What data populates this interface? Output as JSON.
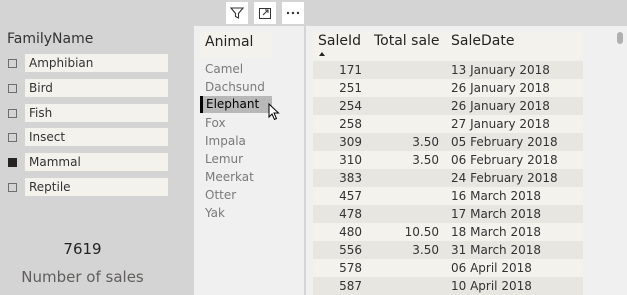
{
  "family_slicer": {
    "title": "FamilyName",
    "items": [
      {
        "label": "Amphibian",
        "checked": false
      },
      {
        "label": "Bird",
        "checked": false
      },
      {
        "label": "Fish",
        "checked": false
      },
      {
        "label": "Insect",
        "checked": false
      },
      {
        "label": "Mammal",
        "checked": true
      },
      {
        "label": "Reptile",
        "checked": false
      }
    ]
  },
  "card": {
    "value": "7619",
    "label": "Number of sales"
  },
  "visual_header": {
    "icons": [
      "filter-icon",
      "focus-mode-icon",
      "more-options-icon"
    ]
  },
  "animal_table": {
    "header": "Animal",
    "rows": [
      "Camel",
      "Dachsund",
      "Elephant",
      "Fox",
      "Impala",
      "Lemur",
      "Meerkat",
      "Otter",
      "Yak"
    ],
    "selected": "Elephant"
  },
  "sales_table": {
    "headers": {
      "id": "SaleId",
      "total": "Total sale",
      "date": "SaleDate"
    },
    "rows": [
      {
        "id": "171",
        "total": "",
        "date": "13 January 2018"
      },
      {
        "id": "251",
        "total": "",
        "date": "26 January 2018"
      },
      {
        "id": "254",
        "total": "",
        "date": "26 January 2018"
      },
      {
        "id": "258",
        "total": "",
        "date": "27 January 2018"
      },
      {
        "id": "309",
        "total": "3.50",
        "date": "05 February 2018"
      },
      {
        "id": "310",
        "total": "3.50",
        "date": "06 February 2018"
      },
      {
        "id": "383",
        "total": "",
        "date": "24 February 2018"
      },
      {
        "id": "457",
        "total": "",
        "date": "16 March 2018"
      },
      {
        "id": "478",
        "total": "",
        "date": "17 March 2018"
      },
      {
        "id": "480",
        "total": "10.50",
        "date": "18 March 2018"
      },
      {
        "id": "556",
        "total": "3.50",
        "date": "31 March 2018"
      },
      {
        "id": "578",
        "total": "",
        "date": "06 April 2018"
      },
      {
        "id": "587",
        "total": "",
        "date": "10 April 2018"
      }
    ]
  }
}
